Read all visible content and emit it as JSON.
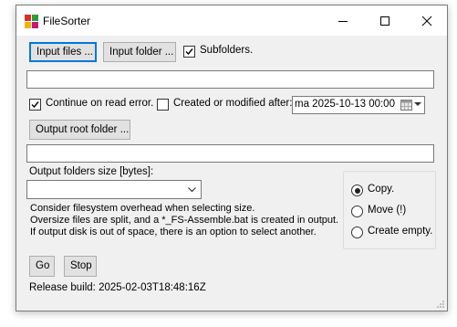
{
  "window": {
    "title": "FileSorter"
  },
  "input": {
    "files_button": "Input files ...",
    "folder_button": "Input folder ...",
    "subfolders_label": "Subfolders.",
    "subfolders_checked": true,
    "path_value": ""
  },
  "options": {
    "continue_label": "Continue on read error.",
    "continue_checked": true,
    "modified_label": "Created or modified after:",
    "modified_checked": false,
    "date_value": "ma 2025-10-13 00:00"
  },
  "output": {
    "root_button": "Output root folder ...",
    "path_value": "",
    "size_label": "Output folders size [bytes]:",
    "size_value": ""
  },
  "notes": [
    "Consider filesystem overhead when selecting size.",
    "Oversize files are split, and a *_FS-Assemble.bat is created in output.",
    "If output disk is out of space, there is an option to select another."
  ],
  "mode": {
    "copy_label": "Copy.",
    "move_label": "Move (!)",
    "create_empty_label": "Create empty.",
    "selected": "copy"
  },
  "actions": {
    "go_label": "Go",
    "stop_label": "Stop"
  },
  "release": "Release build: 2025-02-03T18:48:16Z"
}
